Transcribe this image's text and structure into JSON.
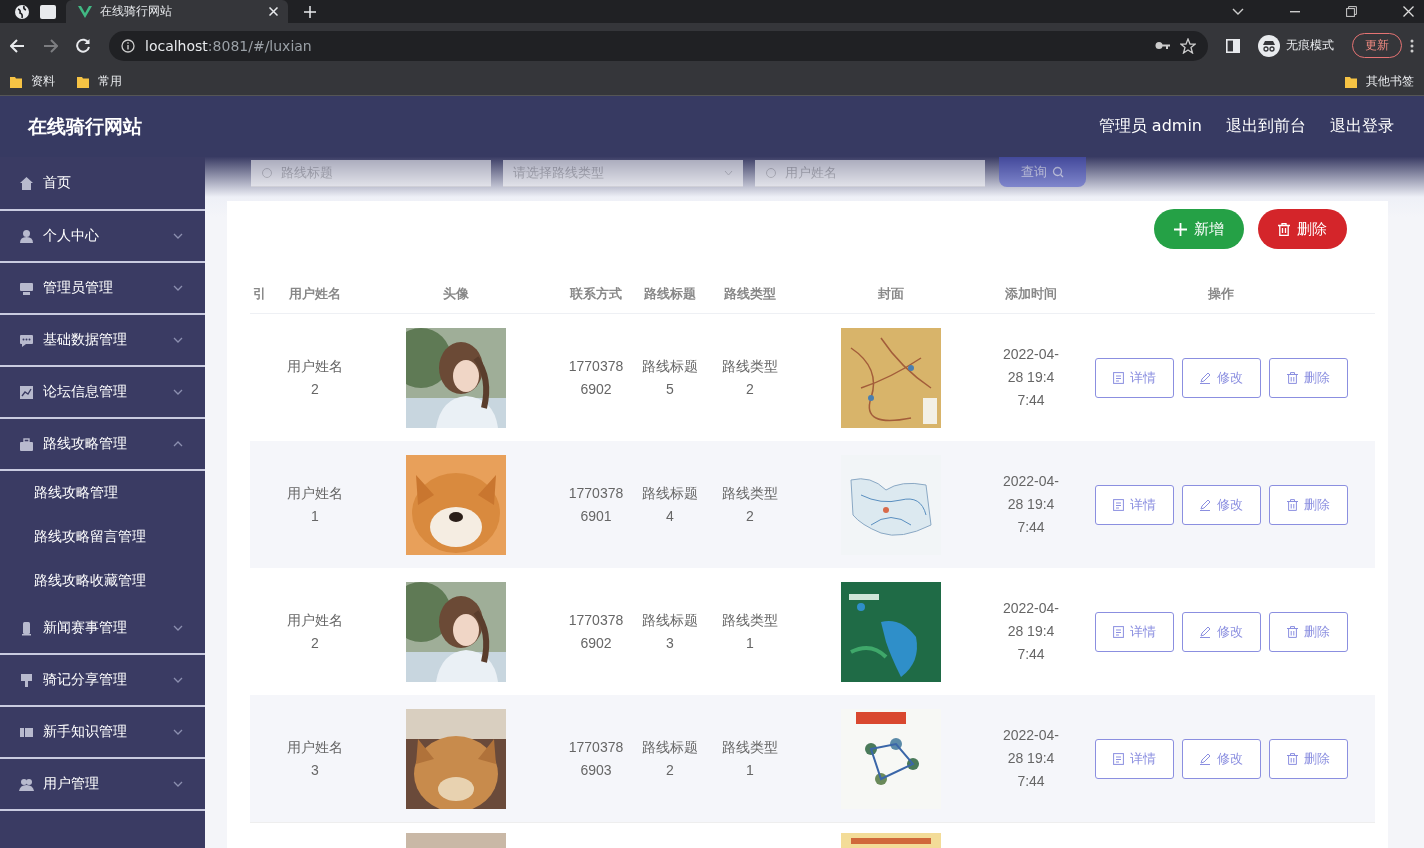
{
  "browser": {
    "tabs": [
      {
        "title": "在线骑行网站",
        "selected": true
      }
    ],
    "url_host": "localhost",
    "url_rest": ":8081/#/luxian",
    "incognito_label": "无痕模式",
    "update_button": "更新",
    "bookmarks": [
      "资料",
      "常用"
    ],
    "other_bookmarks": "其他书签"
  },
  "header": {
    "title": "在线骑行网站",
    "actions": [
      "管理员 admin",
      "退出到前台",
      "退出登录"
    ]
  },
  "sidebar": {
    "items": [
      {
        "label": "首页",
        "kind": "link"
      },
      {
        "label": "个人中心",
        "kind": "menu",
        "expanded": false
      },
      {
        "label": "管理员管理",
        "kind": "menu",
        "expanded": false
      },
      {
        "label": "基础数据管理",
        "kind": "menu",
        "expanded": false
      },
      {
        "label": "论坛信息管理",
        "kind": "menu",
        "expanded": false
      },
      {
        "label": "路线攻略管理",
        "kind": "menu",
        "expanded": true,
        "children": [
          {
            "label": "路线攻略管理"
          },
          {
            "label": "路线攻略留言管理"
          },
          {
            "label": "路线攻略收藏管理"
          }
        ]
      },
      {
        "label": "新闻赛事管理",
        "kind": "menu",
        "expanded": false
      },
      {
        "label": "骑记分享管理",
        "kind": "menu",
        "expanded": false
      },
      {
        "label": "新手知识管理",
        "kind": "menu",
        "expanded": false
      },
      {
        "label": "用户管理",
        "kind": "menu",
        "expanded": false
      }
    ]
  },
  "search": {
    "fields": [
      {
        "placeholder": "路线标题",
        "kind": "text"
      },
      {
        "placeholder": "请选择路线类型",
        "kind": "select"
      },
      {
        "placeholder": "用户姓名",
        "kind": "text"
      }
    ],
    "button": "查询"
  },
  "actions": {
    "add": "新增",
    "delete": "删除"
  },
  "table": {
    "columns": [
      "引",
      "用户姓名",
      "头像",
      "联系方式",
      "路线标题",
      "路线类型",
      "封面",
      "添加时间",
      "操作"
    ],
    "rows": [
      {
        "kind": "full",
        "user": "用户姓名2",
        "phone": "17703786902",
        "title": "路线标题5",
        "type": "路线类型2",
        "time": "2022-04-28 19:47:44",
        "actions": [
          "详情",
          "修改",
          "删除"
        ]
      },
      {
        "kind": "full",
        "user": "用户姓名1",
        "phone": "17703786901",
        "title": "路线标题4",
        "type": "路线类型2",
        "time": "2022-04-28 19:47:44",
        "actions": [
          "详情",
          "修改",
          "删除"
        ]
      },
      {
        "kind": "full",
        "user": "用户姓名2",
        "phone": "17703786902",
        "title": "路线标题3",
        "type": "路线类型1",
        "time": "2022-04-28 19:47:44",
        "actions": [
          "详情",
          "修改",
          "删除"
        ]
      },
      {
        "kind": "full",
        "user": "用户姓名3",
        "phone": "17703786903",
        "title": "路线标题2",
        "type": "路线类型1",
        "time": "2022-04-28 19:47:44",
        "actions": [
          "详情",
          "修改",
          "删除"
        ]
      },
      {
        "kind": "cut"
      }
    ]
  }
}
